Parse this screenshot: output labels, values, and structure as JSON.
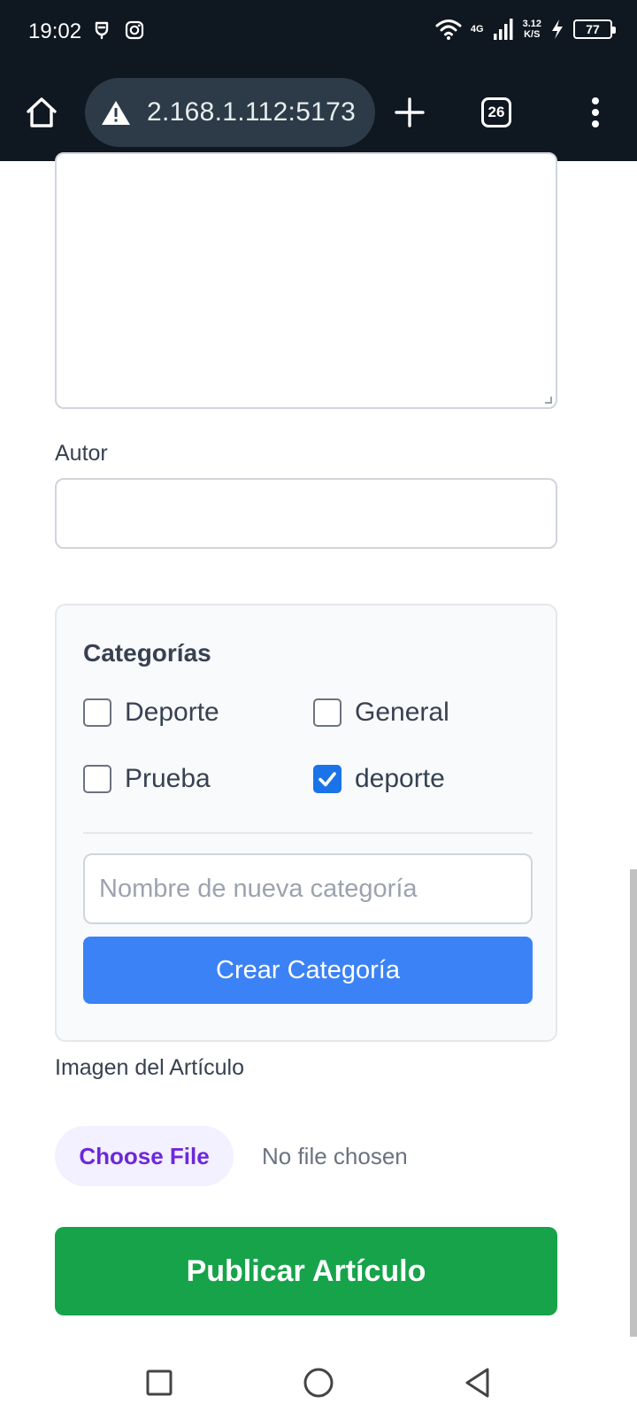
{
  "status_bar": {
    "time": "19:02",
    "network": "4G",
    "speed_value": "3.12",
    "speed_unit": "K/S",
    "battery": "77"
  },
  "browser": {
    "url": "2.168.1.112:5173",
    "tab_count": "26"
  },
  "form": {
    "autor_label": "Autor",
    "autor_value": "",
    "categories_title": "Categorías",
    "categories": [
      {
        "label": "Deporte",
        "checked": false
      },
      {
        "label": "General",
        "checked": false
      },
      {
        "label": "Prueba",
        "checked": false
      },
      {
        "label": "deporte",
        "checked": true
      }
    ],
    "new_category_placeholder": "Nombre de nueva categoría",
    "create_category_label": "Crear Categoría",
    "image_label": "Imagen del Artículo",
    "choose_file_label": "Choose File",
    "no_file_label": "No file chosen",
    "publish_label": "Publicar Artículo"
  },
  "colors": {
    "status_bg": "#0f1720",
    "url_pill": "#2c3b47",
    "primary_blue": "#3b82f6",
    "publish_green": "#16a34a",
    "choose_purple": "#6d28d9"
  }
}
